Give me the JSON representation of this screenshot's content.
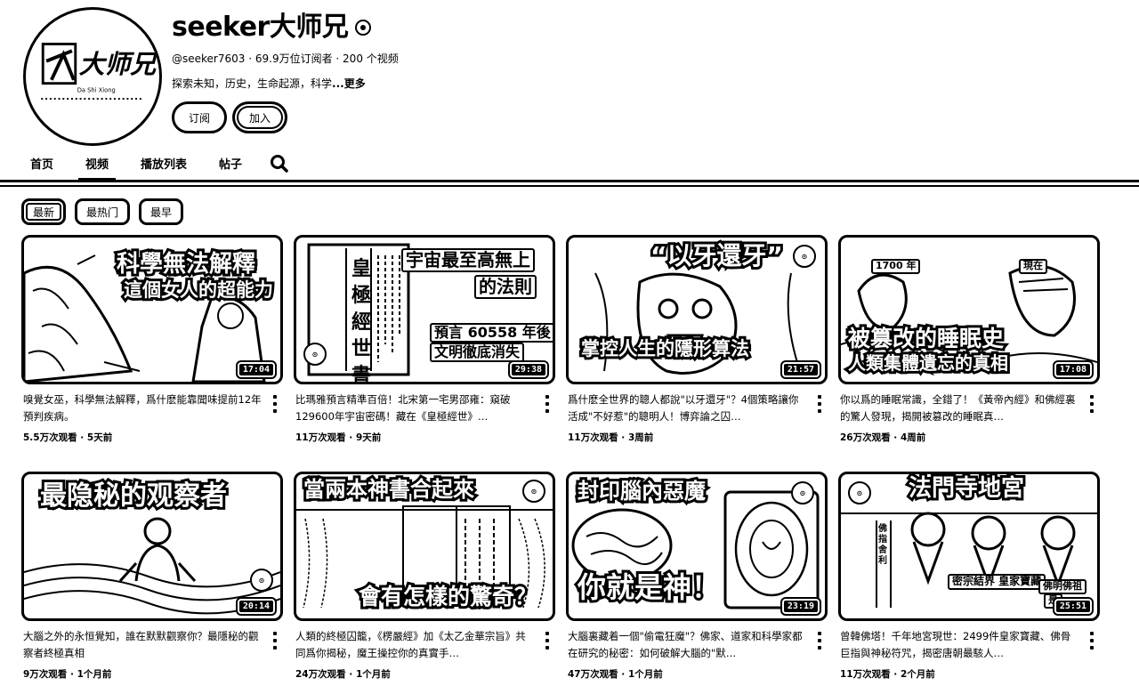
{
  "channel": {
    "name": "seeker大师兄",
    "handle": "@seeker7603",
    "subscribers": "69.9万位订阅者",
    "video_count": "200 个视频",
    "separator": " · ",
    "description": "探索未知，历史，生命起源，科学",
    "more_label": "...更多",
    "avatar_text_cn": "大师兄",
    "avatar_text_latin": "Da Shi Xiong",
    "buttons": {
      "subscribe": "订阅",
      "join": "加入"
    }
  },
  "tabs": [
    {
      "label": "首页",
      "active": false
    },
    {
      "label": "视频",
      "active": true
    },
    {
      "label": "播放列表",
      "active": false
    },
    {
      "label": "帖子",
      "active": false
    }
  ],
  "search_icon": "search-icon",
  "chips": [
    {
      "label": "最新",
      "active": true
    },
    {
      "label": "最热门",
      "active": false
    },
    {
      "label": "最早",
      "active": false
    }
  ],
  "videos": [
    {
      "thumb_lines": [
        "科學無法解釋",
        "這個女人的超能力"
      ],
      "duration": "17:04",
      "title": "嗅覺女巫，科學無法解釋，爲什麽能靠聞味提前12年預判疾病。",
      "views": "5.5万次观看",
      "age": "5天前"
    },
    {
      "thumb_lines": [
        "宇宙最至高無上",
        "的法則",
        "預言 60558 年後",
        "文明徹底消失"
      ],
      "book_text": "皇極經世書傳",
      "duration": "29:38",
      "title": "比瑪雅預言精準百倍！北宋第一宅男邵雍：窺破129600年宇宙密碼！藏在《皇極經世》…",
      "views": "11万次观看",
      "age": "9天前"
    },
    {
      "thumb_lines": [
        "“以牙還牙”",
        "掌控人生的隱形算法"
      ],
      "duration": "21:57",
      "title": "爲什麽全世界的聰人都說\"以牙還牙\"？4個策略讓你活成\"不好惹\"的聰明人！博弈論之囚…",
      "views": "11万次观看",
      "age": "3周前"
    },
    {
      "thumb_lines": [
        "被篡改的睡眠史",
        "人類集體遺忘的真相"
      ],
      "tags": [
        "1700 年",
        "現在"
      ],
      "duration": "17:08",
      "title": "你以爲的睡眠常識，全錯了！《黃帝內經》和佛經裏的驚人發現，揭開被篡改的睡眠真…",
      "views": "26万次观看",
      "age": "4周前"
    },
    {
      "thumb_lines": [
        "最隐秘的观察者"
      ],
      "duration": "20:14",
      "title": "大腦之外的永恒覺知，誰在默默觀察你？最隱秘的觀察者終極真相",
      "views": "9万次观看",
      "age": "1个月前"
    },
    {
      "thumb_lines": [
        "當兩本神書合起來",
        "會有怎樣的驚奇？"
      ],
      "duration": "",
      "title": "人類的終極囚籠，《楞嚴經》加《太乙金華宗旨》共同爲你揭秘，魔王操控你的真實手…",
      "views": "24万次观看",
      "age": "1个月前"
    },
    {
      "thumb_lines": [
        "封印腦內惡魔",
        "你就是神！"
      ],
      "duration": "23:19",
      "title": "大腦裏藏着一個\"偷電狂魔\"？佛家、道家和科學家都在研究的秘密：如何破解大腦的\"默…",
      "views": "47万次观看",
      "age": "1个月前"
    },
    {
      "thumb_lines": [
        "法門寺地宮",
        "密宗結界 皇家寶藏",
        "佛指舍利",
        "佛明佛祖",
        "是"
      ],
      "duration": "25:51",
      "title": "曾韓佛塔！千年地宮現世：2499件皇家寶藏、佛骨巨指與神秘符咒，揭密唐朝最駭人…",
      "views": "11万次观看",
      "age": "2个月前"
    }
  ]
}
